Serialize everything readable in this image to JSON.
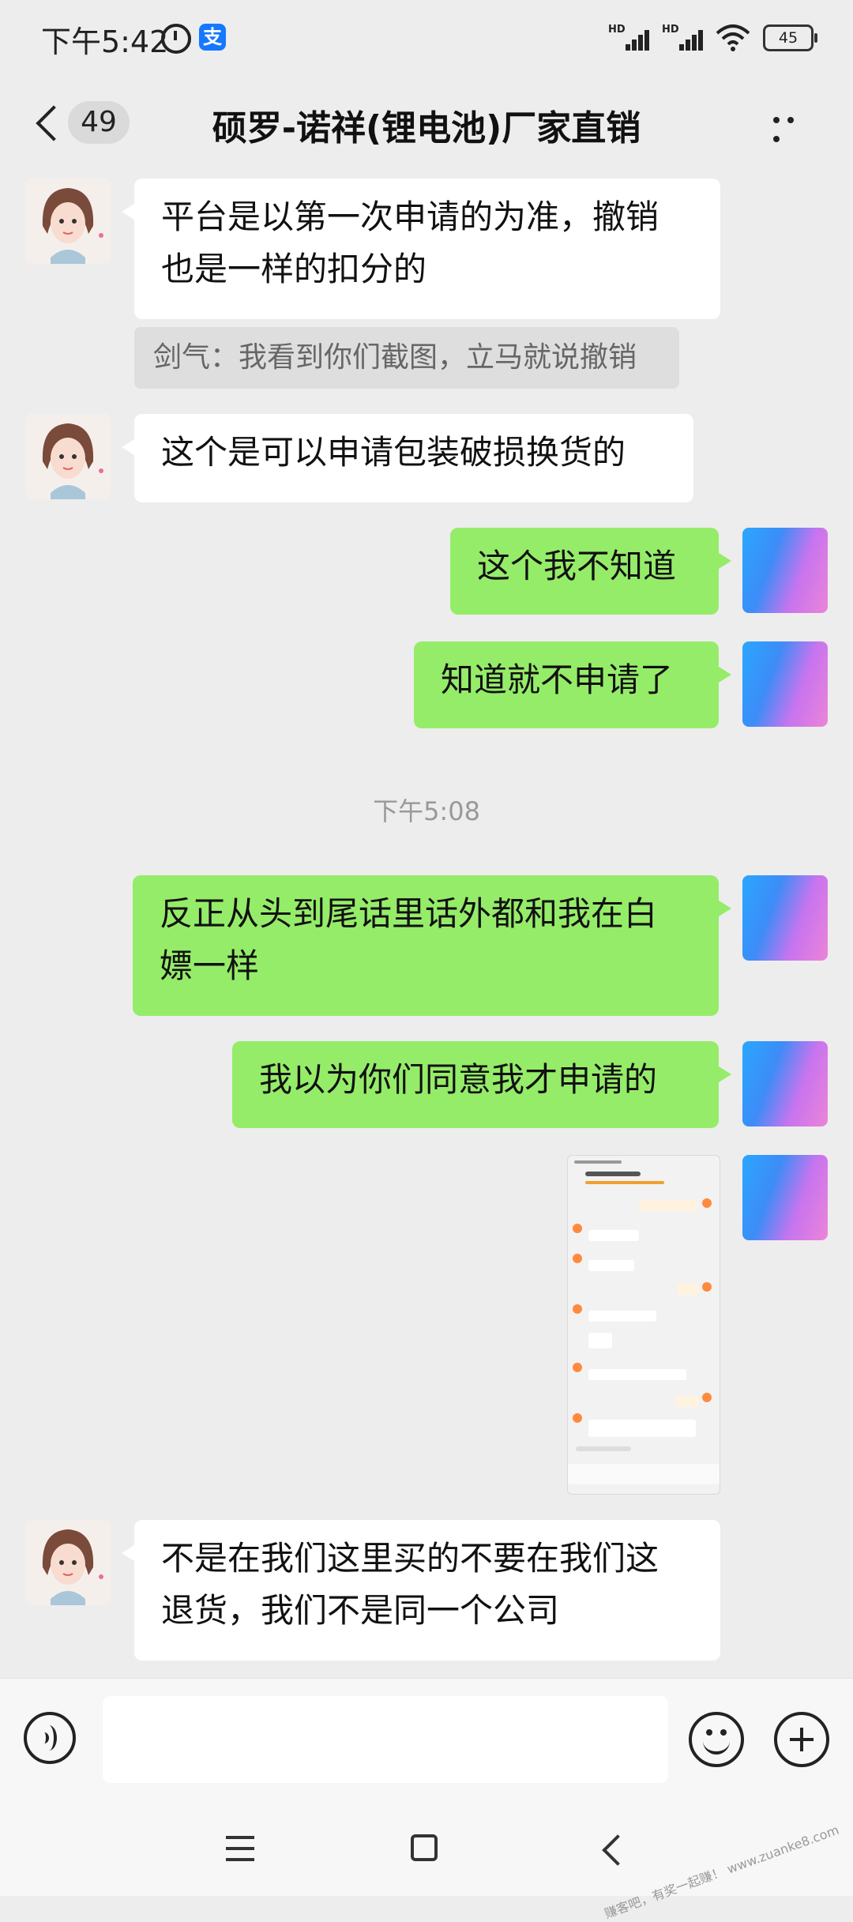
{
  "status_bar": {
    "time": "下午5:42",
    "app_badge": "支",
    "signal_labels": [
      "HD",
      "HD"
    ],
    "battery": "45",
    "icons": [
      "alarm-icon",
      "alipay-icon",
      "signal-icon",
      "signal-icon",
      "wifi-icon",
      "battery-icon"
    ]
  },
  "header": {
    "unread_count": "49",
    "title": "硕罗-诺祥(锂电池)厂家直销",
    "more_icon": "more-dots-icon",
    "back_icon": "back-arrow-icon"
  },
  "messages": [
    {
      "side": "in",
      "text_line1": "平台是以第一次申请的为准，撤销",
      "text_line2": "也是一样的扣分的"
    },
    {
      "side": "quote",
      "text": "剑气：我看到你们截图，立马就说撤销"
    },
    {
      "side": "in",
      "text": "这个是可以申请包装破损换货的"
    },
    {
      "side": "out",
      "text": "这个我不知道"
    },
    {
      "side": "out",
      "text": "知道就不申请了"
    },
    {
      "side": "timestamp",
      "text": "下午5:08"
    },
    {
      "side": "out",
      "text_line1": "反正从头到尾话里话外都和我在白",
      "text_line2": "嫖一样"
    },
    {
      "side": "out",
      "text": "我以为你们同意我才申请的"
    },
    {
      "side": "out",
      "type": "image",
      "description_name": "chat-screenshot-image"
    },
    {
      "side": "in",
      "text_line1": "不是在我们这里买的不要在我们这",
      "text_line2": "退货，我们不是同一个公司"
    }
  ],
  "input_bar": {
    "voice_icon": "voice-icon",
    "emoji_icon": "emoji-icon",
    "plus_icon": "plus-icon"
  },
  "nav_bar": {
    "icons": [
      "menu-icon",
      "home-icon",
      "back-icon"
    ]
  },
  "watermark": "赚客吧，有奖一起赚！ www.zuanke8.com"
}
